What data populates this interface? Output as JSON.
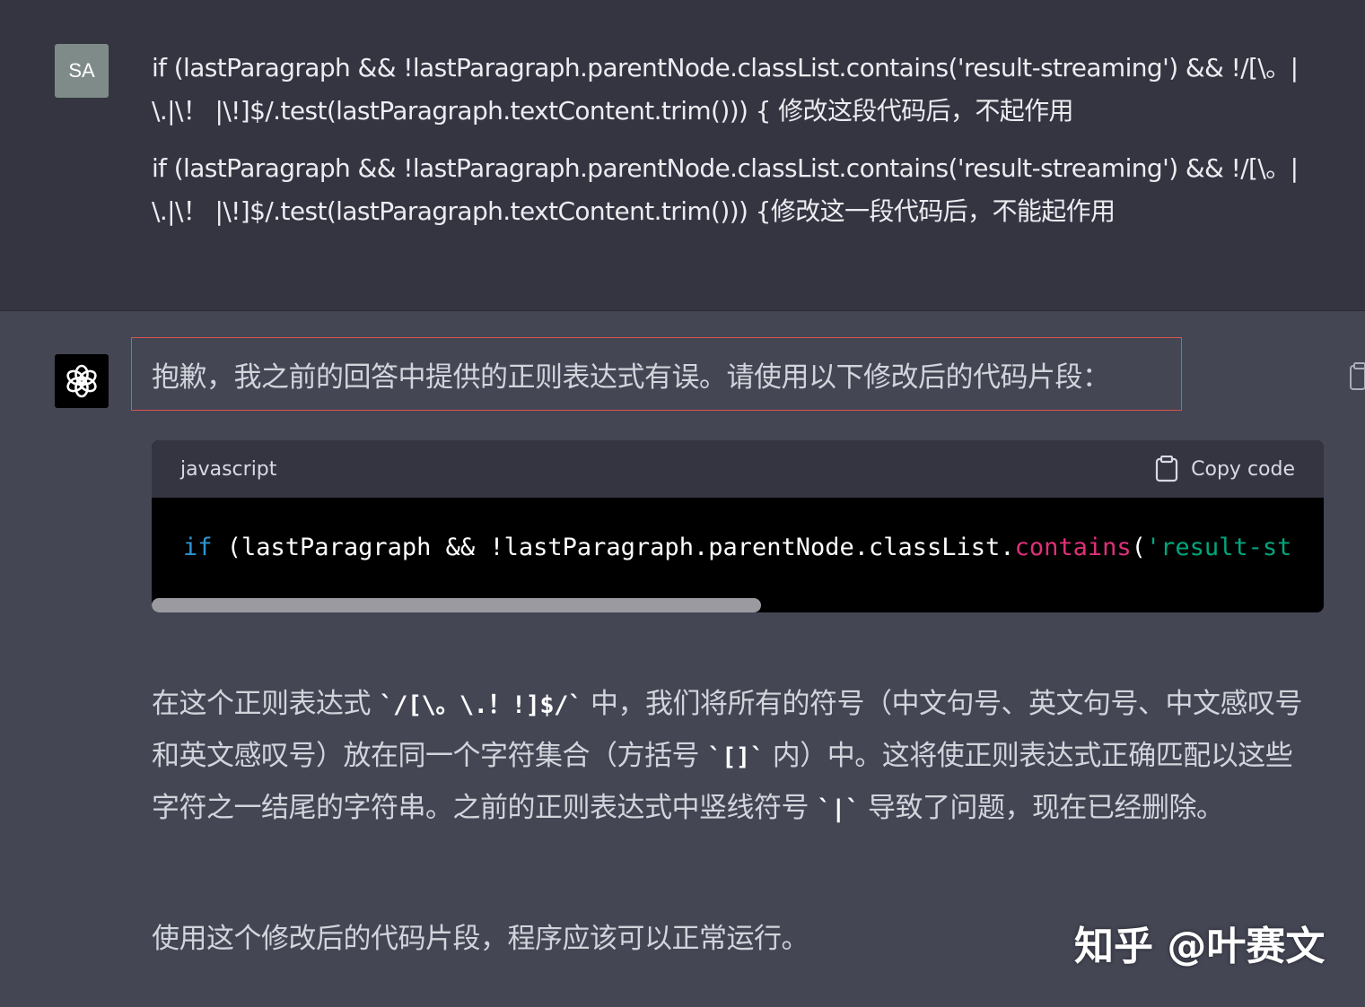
{
  "user": {
    "avatar_initials": "SA",
    "messages": [
      "if (lastParagraph && !lastParagraph.parentNode.classList.contains('result-streaming') && !/[\\。|\\.|\\！ |\\!]$/.test(lastParagraph.textContent.trim())) {     修改这段代码后，不起作用",
      "if (lastParagraph && !lastParagraph.parentNode.classList.contains('result-streaming') && !/[\\。|\\.|\\！ |\\!]$/.test(lastParagraph.textContent.trim())) {修改这一段代码后，不能起作用"
    ]
  },
  "assistant": {
    "apology": "抱歉，我之前的回答中提供的正则表达式有误。请使用以下修改后的代码片段：",
    "code_block": {
      "language": "javascript",
      "copy_label": "Copy code",
      "code_kw": "if",
      "code_plain": " (lastParagraph && !lastParagraph.parentNode.classList.",
      "code_fn": "contains",
      "code_paren": "(",
      "code_str": "'result-st",
      "scroll_fraction": 0.52
    },
    "explanation": {
      "part1": "在这个正则表达式 ",
      "code1": "`/[\\。\\.！!]$/`",
      "part2": " 中，我们将所有的符号（中文句号、英文句号、中文感叹号和英文感叹号）放在同一个字符集合（方括号 ",
      "code2": "`[]`",
      "part3": " 内）中。这将使正则表达式正确匹配以这些字符之一结尾的字符串。之前的正则表达式中竖线符号 ",
      "code3": "`|`",
      "part4": " 导致了问题，现在已经删除。"
    },
    "final": "使用这个修改后的代码片段，程序应该可以正常运行。"
  },
  "watermark": "知乎 @叶赛文",
  "colors": {
    "user_bg": "#343541",
    "assistant_bg": "#444654",
    "highlight_border": "#d9534f",
    "keyword": "#2e95d3",
    "function": "#df3079",
    "string": "#00a67d"
  }
}
